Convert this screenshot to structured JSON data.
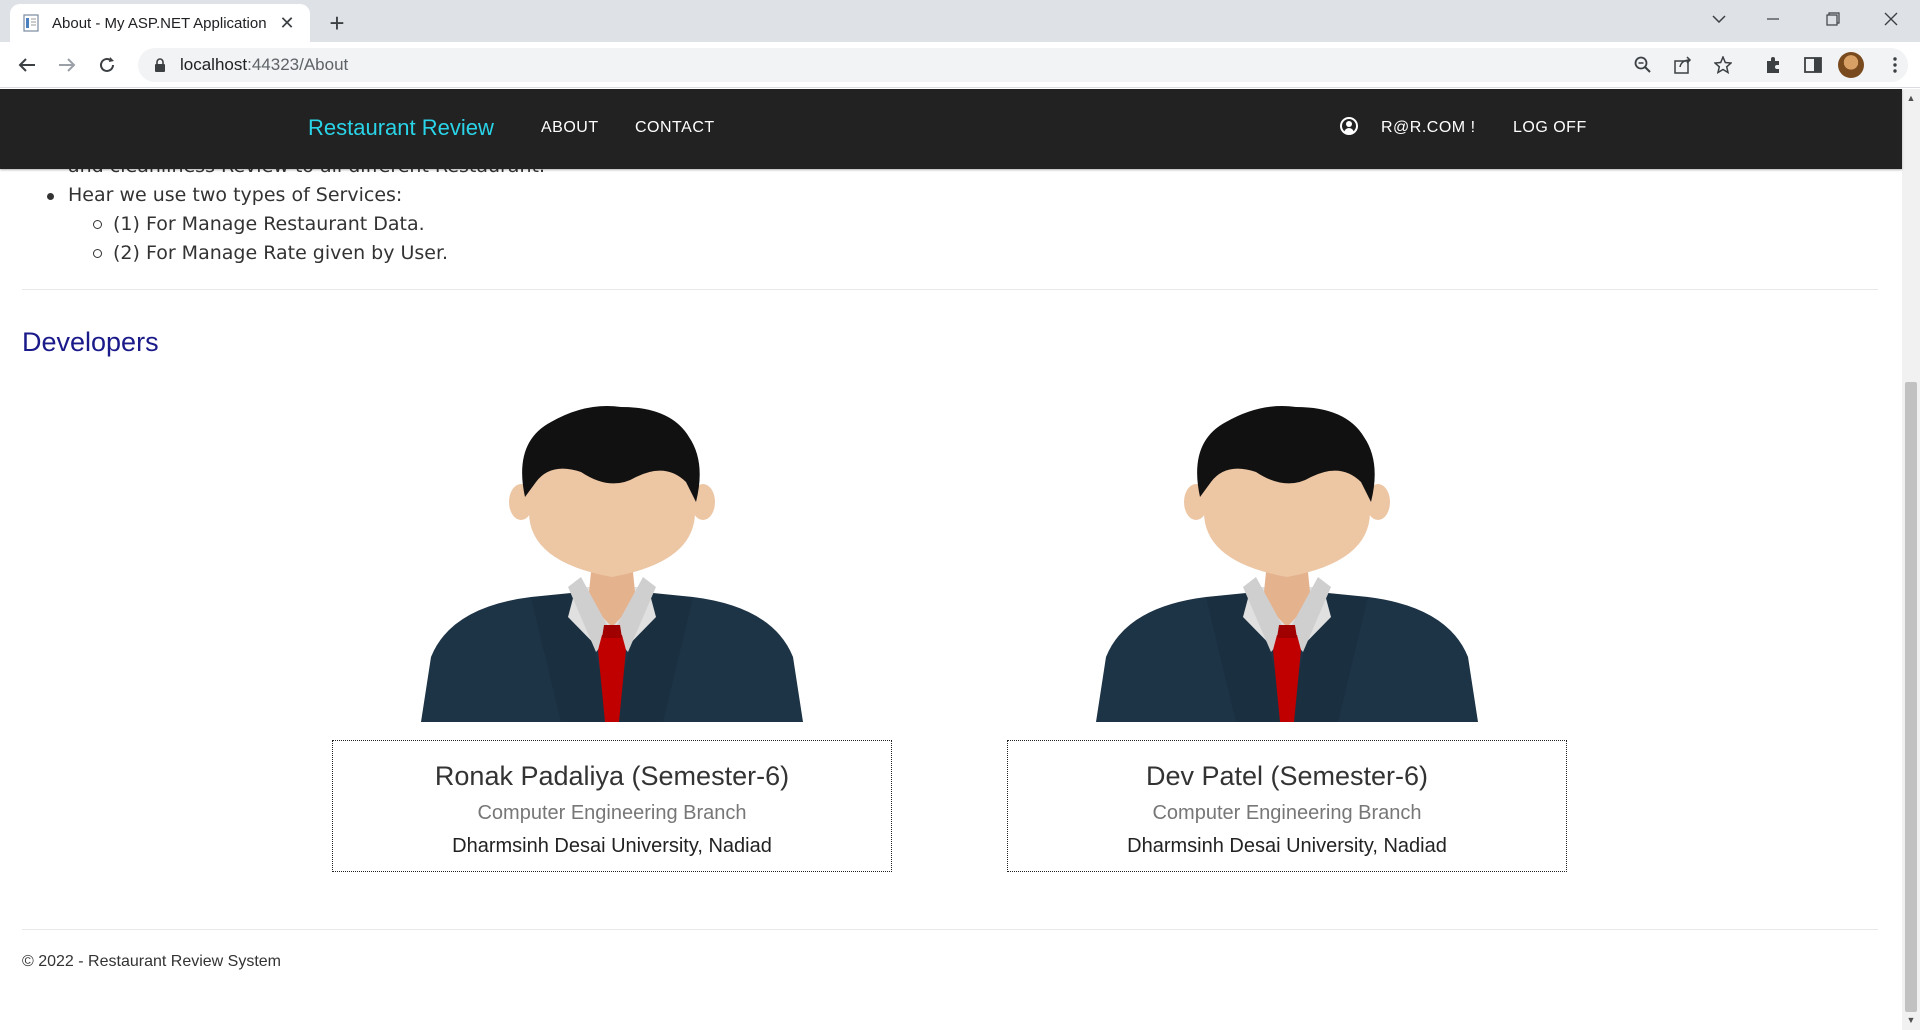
{
  "browser": {
    "tab_title": "About - My ASP.NET Application",
    "url_host": "localhost",
    "url_path": ":44323/About"
  },
  "navbar": {
    "brand": "Restaurant Review",
    "links": [
      "ABOUT",
      "CONTACT"
    ],
    "user_label": "R@R.COM !",
    "logoff_label": "LOG OFF"
  },
  "about": {
    "cut_off_text": "and cleanliness Review to all different Restaurant.",
    "services_intro": "Hear we use two types of Services:",
    "services": [
      "(1) For Manage Restaurant Data.",
      "(2) For Manage Rate given by User."
    ]
  },
  "developers": {
    "title": "Developers",
    "people": [
      {
        "name": "Ronak Padaliya (Semester-6)",
        "branch": "Computer Engineering Branch",
        "university": "Dharmsinh Desai University, Nadiad"
      },
      {
        "name": "Dev Patel (Semester-6)",
        "branch": "Computer Engineering Branch",
        "university": "Dharmsinh Desai University, Nadiad"
      }
    ]
  },
  "footer": {
    "text": "© 2022 - Restaurant Review System"
  },
  "colors": {
    "navbar_bg": "#222222",
    "brand": "#2ad4e8",
    "section_title": "#1a1a8a"
  },
  "icons": [
    "page-icon",
    "close-icon",
    "plus-icon",
    "chevron-down-icon",
    "minimize-icon",
    "restore-icon",
    "back-arrow-icon",
    "forward-arrow-icon",
    "reload-icon",
    "lock-icon",
    "zoom-icon",
    "share-icon",
    "star-icon",
    "extensions-icon",
    "sidepanel-icon",
    "menu-icon",
    "user-circle-icon"
  ]
}
